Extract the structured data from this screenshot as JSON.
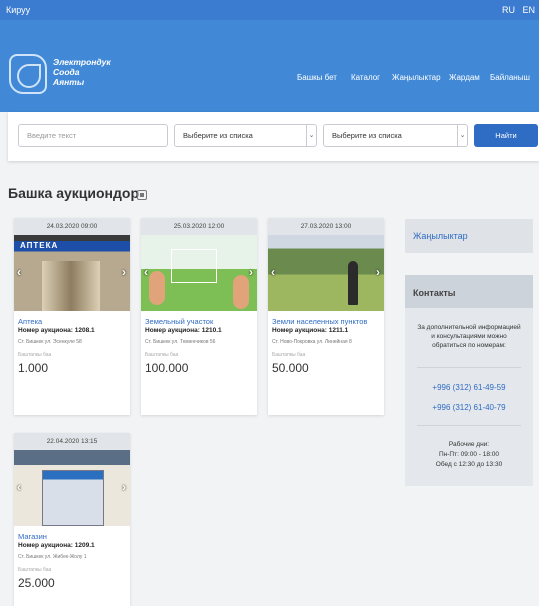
{
  "topbar": {
    "login": "Кируу",
    "langs": [
      "RU",
      "EN"
    ]
  },
  "header": {
    "brand_lines": [
      "Электрондук",
      "Соода",
      "Аянты"
    ],
    "nav": [
      "Башкы бет",
      "Каталог",
      "Жаңылыктар",
      "Жардам",
      "Байланыш"
    ]
  },
  "search": {
    "placeholder": "Введите текст",
    "select1": "Выберите из списка",
    "select2": "Выберите из списка",
    "button": "Найти"
  },
  "page_title": "Башка аукциондор",
  "cards": [
    {
      "date": "24.03.2020 09:00",
      "name": "Аптека",
      "lot": "Номер аукциона: 1208.1",
      "address": "Ст. Бишкек ул. Эсенкуле 58",
      "price_label": "Баштапкы баа",
      "price": "1.000",
      "sign": "АПТЕКА"
    },
    {
      "date": "25.03.2020 12:00",
      "name": "Земельный участок",
      "lot": "Номер аукциона: 1210.1",
      "address": "Ст. Бишкек ул. Тюменчиков 56",
      "price_label": "Баштапкы баа",
      "price": "100.000"
    },
    {
      "date": "27.03.2020 13:00",
      "name": "Земли населенных пунктов",
      "lot": "Номер аукциона: 1211.1",
      "address": "Ст. Ново-Покровка ул. Линейная 8",
      "price_label": "Баштапкы баа",
      "price": "50.000"
    },
    {
      "date": "22.04.2020 13:15",
      "name": "Магазин",
      "lot": "Номер аукциона: 1209.1",
      "address": "Ст. Бишкек ул. Жибек-Жолу 1",
      "price_label": "Баштапкы баа",
      "price": "25.000"
    }
  ],
  "sidebar": {
    "news": "Жаңылыктар",
    "contacts_title": "Контакты",
    "contacts_info": "За дополнительной информацией и консультациями можно обратиться по номерам:",
    "phones": [
      "+996 (312) 61-49-59",
      "+996 (312) 61-40-79"
    ],
    "hours": [
      "Рабочие дни:",
      "Пн-Пт: 09:00 - 18:00",
      "Обед с 12:30 до 13:30"
    ]
  }
}
